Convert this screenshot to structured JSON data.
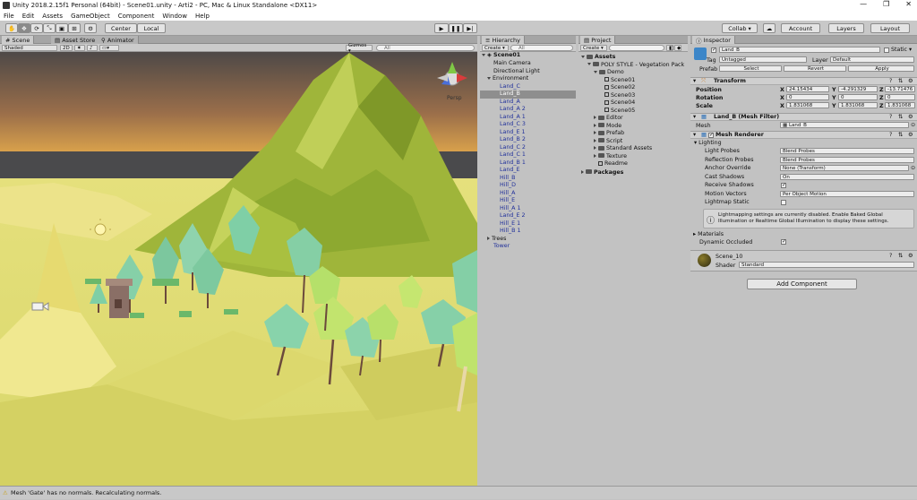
{
  "window": {
    "title": "Unity 2018.2.15f1 Personal (64bit) - Scene01.unity - Arti2 - PC, Mac & Linux Standalone <DX11>"
  },
  "menu": [
    "File",
    "Edit",
    "Assets",
    "GameObject",
    "Component",
    "Window",
    "Help"
  ],
  "toolbar": {
    "center": "Center",
    "local": "Local",
    "collab": "Collab ▾",
    "account": "Account",
    "layers": "Layers",
    "layout": "Layout"
  },
  "scene": {
    "tabs": [
      "Scene",
      "Asset Store",
      "Animator"
    ],
    "shading": "Shaded",
    "mode2d": "2D",
    "gizmos": "Gizmos ▾",
    "search": "All",
    "persp": "Persp"
  },
  "hierarchy": {
    "tab": "Hierarchy",
    "create": "Create ▾",
    "search": "All",
    "scene": "Scene01",
    "items": [
      {
        "label": "Main Camera",
        "indent": 1,
        "blue": false,
        "sel": false,
        "arrow": ""
      },
      {
        "label": "Directional Light",
        "indent": 1,
        "blue": false,
        "sel": false,
        "arrow": ""
      },
      {
        "label": "Environment",
        "indent": 0,
        "blue": false,
        "sel": false,
        "arrow": "down"
      },
      {
        "label": "Land_C",
        "indent": 2,
        "blue": true,
        "sel": false,
        "arrow": ""
      },
      {
        "label": "Land_B",
        "indent": 2,
        "blue": true,
        "sel": true,
        "arrow": ""
      },
      {
        "label": "Land_A",
        "indent": 2,
        "blue": true,
        "sel": false,
        "arrow": ""
      },
      {
        "label": "Land_A 2",
        "indent": 2,
        "blue": true,
        "sel": false,
        "arrow": ""
      },
      {
        "label": "Land_A 1",
        "indent": 2,
        "blue": true,
        "sel": false,
        "arrow": ""
      },
      {
        "label": "Land_C 3",
        "indent": 2,
        "blue": true,
        "sel": false,
        "arrow": ""
      },
      {
        "label": "Land_E 1",
        "indent": 2,
        "blue": true,
        "sel": false,
        "arrow": ""
      },
      {
        "label": "Land_B 2",
        "indent": 2,
        "blue": true,
        "sel": false,
        "arrow": ""
      },
      {
        "label": "Land_C 2",
        "indent": 2,
        "blue": true,
        "sel": false,
        "arrow": ""
      },
      {
        "label": "Land_C 1",
        "indent": 2,
        "blue": true,
        "sel": false,
        "arrow": ""
      },
      {
        "label": "Land_B 1",
        "indent": 2,
        "blue": true,
        "sel": false,
        "arrow": ""
      },
      {
        "label": "Land_E",
        "indent": 2,
        "blue": true,
        "sel": false,
        "arrow": ""
      },
      {
        "label": "Hill_B",
        "indent": 2,
        "blue": true,
        "sel": false,
        "arrow": ""
      },
      {
        "label": "Hill_D",
        "indent": 2,
        "blue": true,
        "sel": false,
        "arrow": ""
      },
      {
        "label": "Hill_A",
        "indent": 2,
        "blue": true,
        "sel": false,
        "arrow": ""
      },
      {
        "label": "Hill_E",
        "indent": 2,
        "blue": true,
        "sel": false,
        "arrow": ""
      },
      {
        "label": "Hill_A 1",
        "indent": 2,
        "blue": true,
        "sel": false,
        "arrow": ""
      },
      {
        "label": "Land_E 2",
        "indent": 2,
        "blue": true,
        "sel": false,
        "arrow": ""
      },
      {
        "label": "Hill_E 1",
        "indent": 2,
        "blue": true,
        "sel": false,
        "arrow": ""
      },
      {
        "label": "Hill_B 1",
        "indent": 2,
        "blue": true,
        "sel": false,
        "arrow": ""
      },
      {
        "label": "Trees",
        "indent": 0,
        "blue": false,
        "sel": false,
        "arrow": "right"
      },
      {
        "label": "Tower",
        "indent": 1,
        "blue": true,
        "sel": false,
        "arrow": ""
      }
    ]
  },
  "project": {
    "tab": "Project",
    "create": "Create ▾",
    "items": [
      {
        "label": "Assets",
        "indent": 0,
        "bold": true,
        "arrow": "down",
        "icon": "folder"
      },
      {
        "label": "POLY STYLE - Vegetation Pack",
        "indent": 1,
        "bold": false,
        "arrow": "down",
        "icon": "folder"
      },
      {
        "label": "Demo",
        "indent": 2,
        "bold": false,
        "arrow": "down",
        "icon": "folder"
      },
      {
        "label": "Scene01",
        "indent": 3,
        "bold": false,
        "arrow": "",
        "icon": "cube"
      },
      {
        "label": "Scene02",
        "indent": 3,
        "bold": false,
        "arrow": "",
        "icon": "cube"
      },
      {
        "label": "Scene03",
        "indent": 3,
        "bold": false,
        "arrow": "",
        "icon": "cube"
      },
      {
        "label": "Scene04",
        "indent": 3,
        "bold": false,
        "arrow": "",
        "icon": "cube"
      },
      {
        "label": "Scene05",
        "indent": 3,
        "bold": false,
        "arrow": "",
        "icon": "cube"
      },
      {
        "label": "Editor",
        "indent": 2,
        "bold": false,
        "arrow": "right",
        "icon": "folder"
      },
      {
        "label": "Mode",
        "indent": 2,
        "bold": false,
        "arrow": "right",
        "icon": "folder"
      },
      {
        "label": "Prefab",
        "indent": 2,
        "bold": false,
        "arrow": "right",
        "icon": "folder"
      },
      {
        "label": "Script",
        "indent": 2,
        "bold": false,
        "arrow": "right",
        "icon": "folder"
      },
      {
        "label": "Standard Assets",
        "indent": 2,
        "bold": false,
        "arrow": "right",
        "icon": "folder"
      },
      {
        "label": "Texture",
        "indent": 2,
        "bold": false,
        "arrow": "right",
        "icon": "folder"
      },
      {
        "label": "Readme",
        "indent": 2,
        "bold": false,
        "arrow": "",
        "icon": "cube"
      },
      {
        "label": "Packages",
        "indent": 0,
        "bold": true,
        "arrow": "right",
        "icon": "folder"
      }
    ]
  },
  "inspector": {
    "tab": "Inspector",
    "name": "Land_B",
    "static": "Static ▾",
    "tag_label": "Tag",
    "tag": "Untagged",
    "layer_label": "Layer",
    "layer": "Default",
    "prefab_label": "Prefab",
    "select": "Select",
    "revert": "Revert",
    "apply": "Apply",
    "transform": {
      "title": "Transform",
      "position": {
        "label": "Position",
        "x": "24.15434",
        "y": "-4.291329",
        "z": "-13.71476"
      },
      "rotation": {
        "label": "Rotation",
        "x": "0",
        "y": "0",
        "z": "0"
      },
      "scale": {
        "label": "Scale",
        "x": "1.831068",
        "y": "1.831068",
        "z": "1.831068"
      }
    },
    "meshfilter": {
      "title": "Land_B (Mesh Filter)",
      "mesh_label": "Mesh",
      "mesh": "Land_B"
    },
    "renderer": {
      "title": "Mesh Renderer",
      "lighting": "Lighting",
      "rows": [
        {
          "label": "Light Probes",
          "value": "Blend Probes",
          "type": "dropdown"
        },
        {
          "label": "Reflection Probes",
          "value": "Blend Probes",
          "type": "dropdown"
        },
        {
          "label": "Anchor Override",
          "value": "None (Transform)",
          "type": "object"
        },
        {
          "label": "Cast Shadows",
          "value": "On",
          "type": "dropdown"
        },
        {
          "label": "Receive Shadows",
          "value": "",
          "type": "check_on"
        },
        {
          "label": "Motion Vectors",
          "value": "Per Object Motion",
          "type": "dropdown"
        },
        {
          "label": "Lightmap Static",
          "value": "",
          "type": "check_off"
        }
      ],
      "info": "Lightmapping settings are currently disabled. Enable Baked Global Illumination or Realtime Global Illumination to display these settings.",
      "materials": "Materials",
      "dyn_occluded": "Dynamic Occluded"
    },
    "material": {
      "name": "Scene_10",
      "shader_label": "Shader",
      "shader": "Standard"
    },
    "add_component": "Add Component"
  },
  "status": "Mesh 'Gate' has no normals. Recalculating normals.",
  "colors": {
    "sky_top": "#3f3f47",
    "sky_horizon": "#f3b34a",
    "ground": "#dede72",
    "hill": "#a5be3c",
    "tree": "#7fcfa6",
    "trunk": "#6b4a3c"
  }
}
